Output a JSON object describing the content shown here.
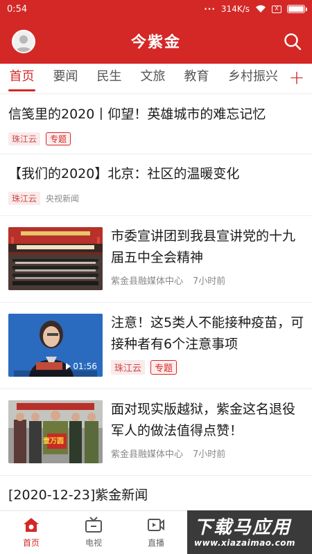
{
  "status_bar": {
    "time": "0:54",
    "dots": "···",
    "speed": "314K/s",
    "sim_label": "X"
  },
  "header": {
    "title": "今紫金"
  },
  "tabs": [
    {
      "label": "首页",
      "active": true
    },
    {
      "label": "要闻"
    },
    {
      "label": "民生"
    },
    {
      "label": "文旅"
    },
    {
      "label": "教育"
    },
    {
      "label": "乡村振兴"
    }
  ],
  "add_tab_label": "+",
  "feed": {
    "items": [
      {
        "title": "信笺里的2020丨仰望！英雄城市的难忘记忆",
        "source": "珠江云",
        "tag": "专题"
      },
      {
        "title": "【我们的2020】北京：社区的温暖变化",
        "source": "珠江云",
        "source2": "央视新闻"
      },
      {
        "title": "市委宣讲团到我县宣讲党的十九届五中全会精神",
        "source": "紫金县融媒体中心",
        "time": "7小时前"
      },
      {
        "title": "注意！这5类人不能接种疫苗，可接种者有6个注意事项",
        "source": "珠江云",
        "tag": "专题",
        "duration": "01:56"
      },
      {
        "title": "面对现实版越狱，紫金这名退役军人的做法值得点赞！",
        "source": "紫金县融媒体中心",
        "time": "7小时前",
        "banner_text": "壹万圆"
      },
      {
        "title": "[2020-12-23]紫金新闻"
      }
    ]
  },
  "bottom_nav": [
    {
      "label": "首页",
      "icon": "home-icon",
      "active": true
    },
    {
      "label": "电视",
      "icon": "tv-icon"
    },
    {
      "label": "直播",
      "icon": "live-icon"
    }
  ],
  "watermark": {
    "main": "下载马应用",
    "sub": "www.xiazaimao.com"
  },
  "colors": {
    "brand_red": "#d42826",
    "text": "#1a1a1a",
    "muted": "#888888"
  }
}
